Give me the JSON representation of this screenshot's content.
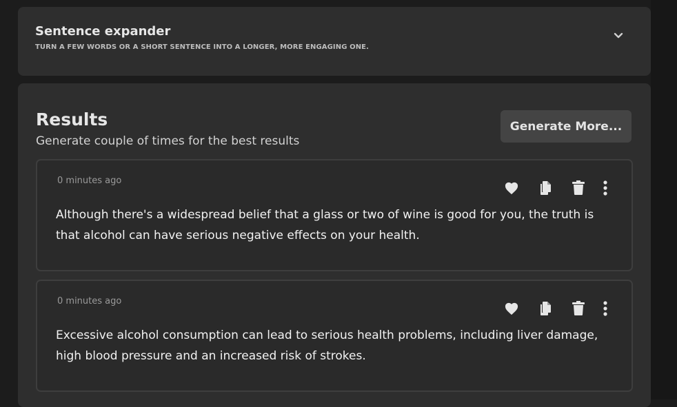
{
  "tool": {
    "title": "Sentence expander",
    "subtitle": "TURN A FEW WORDS OR A SHORT SENTENCE INTO A LONGER, MORE ENGAGING ONE.",
    "expand_icon": "chevron-down-icon"
  },
  "results": {
    "title": "Results",
    "subtitle": "Generate couple of times for the best results",
    "generate_more_label": "Generate More...",
    "items": [
      {
        "timestamp": "0 minutes ago",
        "text": "Although there's a widespread belief that a glass or two of wine is good for you, the truth is that alcohol can have serious negative effects on your health."
      },
      {
        "timestamp": "0 minutes ago",
        "text": "Excessive alcohol consumption can lead to serious health problems, including liver damage, high blood pressure and an increased risk of strokes."
      }
    ],
    "item_actions": [
      "heart-icon",
      "copy-icon",
      "trash-icon",
      "more-vertical-icon"
    ]
  },
  "colors": {
    "background": "#1c1c1c",
    "card": "#2e2e2e",
    "item": "#2a2a2a",
    "button": "#444444",
    "text": "#f2f2f2"
  }
}
